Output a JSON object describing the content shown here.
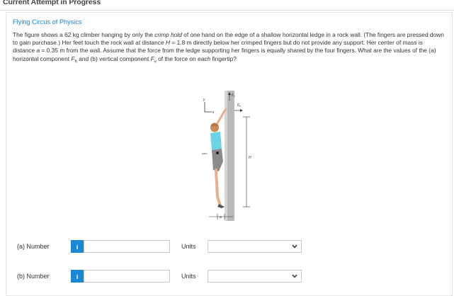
{
  "header": {
    "attempt_status": "Current Attempt in Progress"
  },
  "problem": {
    "title": "Flying Circus of Physics",
    "text_parts": [
      "The figure shows a 62 kg climber hanging by only the ",
      "crimp hold",
      " of one hand on the edge of a shallow horizontal ledge in a rock wall. (The fingers are pressed down to gain purchase.) Her feet touch the rock wall at distance ",
      "H",
      " = 1.8 m directly below her crimped fingers but do not provide any support. Her center of mass is distance ",
      "a",
      " = 0.35 m from the wall. Assume that the force from the ledge supporting her fingers is equally shared by the four fingers. What are the values of the (a) horizontal component ",
      "F",
      "h",
      " and (b) vertical component ",
      "F",
      "v",
      " of the force on ",
      "each",
      " fingertip?"
    ]
  },
  "figure": {
    "labels": {
      "y": "y",
      "x": "x",
      "fv": "F",
      "fv_sub": "v",
      "fh": "F",
      "fh_sub": "h",
      "com": "com",
      "h": "H",
      "a": "a"
    }
  },
  "answers": [
    {
      "label": "(a)   Number",
      "info": "i",
      "value": "",
      "units_label": "Units",
      "units_value": ""
    },
    {
      "label": "(b)   Number",
      "info": "i",
      "value": "",
      "units_label": "Units",
      "units_value": ""
    }
  ],
  "colors": {
    "link_blue": "#1f7fd1",
    "info_button": "#1a86d6",
    "shirt": "#6ad3e6",
    "shorts": "#8a8a8a"
  }
}
